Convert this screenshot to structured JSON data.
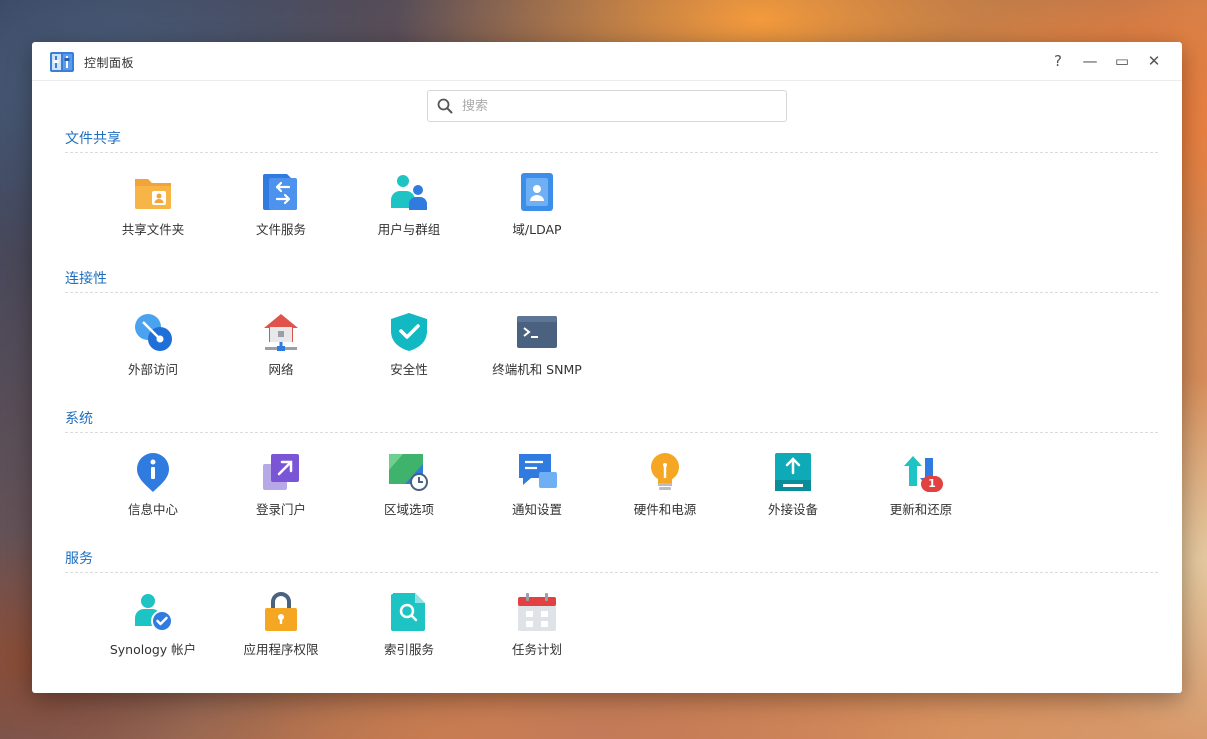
{
  "window": {
    "title": "控制面板"
  },
  "controls": {
    "help": "?",
    "minimize": "—",
    "maximize": "▭",
    "close": "✕"
  },
  "search": {
    "placeholder": "搜索"
  },
  "sections": [
    {
      "title": "文件共享",
      "items": [
        {
          "label": "共享文件夹",
          "icon": "shared-folder-icon"
        },
        {
          "label": "文件服务",
          "icon": "file-services-icon"
        },
        {
          "label": "用户与群组",
          "icon": "users-groups-icon"
        },
        {
          "label": "域/LDAP",
          "icon": "domain-ldap-icon"
        }
      ]
    },
    {
      "title": "连接性",
      "items": [
        {
          "label": "外部访问",
          "icon": "external-access-icon"
        },
        {
          "label": "网络",
          "icon": "network-icon"
        },
        {
          "label": "安全性",
          "icon": "security-shield-icon"
        },
        {
          "label": "终端机和 SNMP",
          "icon": "terminal-icon"
        }
      ]
    },
    {
      "title": "系统",
      "items": [
        {
          "label": "信息中心",
          "icon": "info-center-icon"
        },
        {
          "label": "登录门户",
          "icon": "login-portal-icon"
        },
        {
          "label": "区域选项",
          "icon": "regional-options-icon"
        },
        {
          "label": "通知设置",
          "icon": "notification-icon"
        },
        {
          "label": "硬件和电源",
          "icon": "hardware-power-icon"
        },
        {
          "label": "外接设备",
          "icon": "external-devices-icon"
        },
        {
          "label": "更新和还原",
          "icon": "update-restore-icon",
          "badge": "1"
        }
      ]
    },
    {
      "title": "服务",
      "items": [
        {
          "label": "Synology 帐户",
          "icon": "synology-account-icon"
        },
        {
          "label": "应用程序权限",
          "icon": "app-privileges-icon"
        },
        {
          "label": "索引服务",
          "icon": "indexing-service-icon"
        },
        {
          "label": "任务计划",
          "icon": "task-scheduler-icon"
        }
      ]
    }
  ]
}
